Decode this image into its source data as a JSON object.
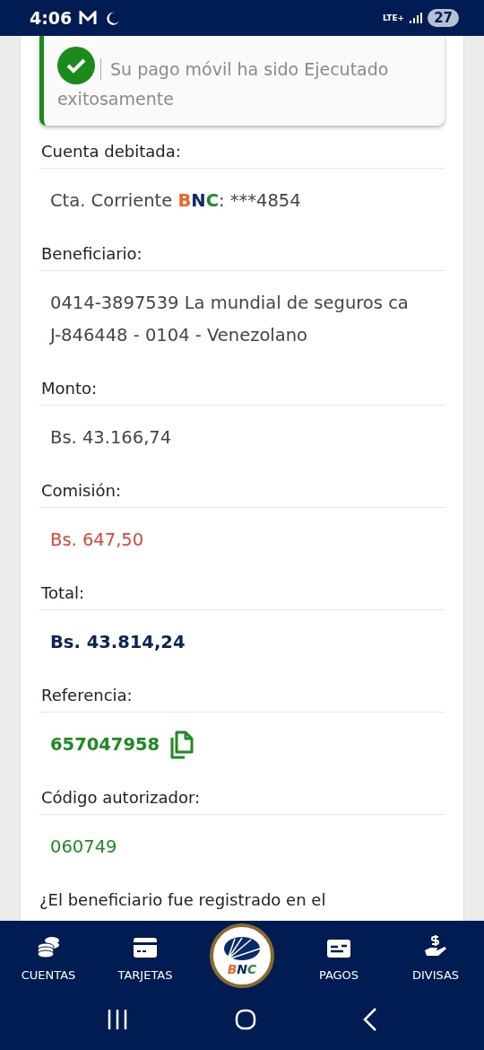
{
  "status_bar": {
    "time": "4:06",
    "network": "LTE+",
    "battery": "27"
  },
  "alert": {
    "message": "Su pago móvil ha sido Ejecutado exitosamente"
  },
  "fields": [
    {
      "label": "Cuenta debitada:",
      "kind": "account",
      "prefix": "Cta. Corriente ",
      "brand": [
        {
          "text": "B",
          "color": "#f26522"
        },
        {
          "text": "N",
          "color": "#0a2a6b"
        },
        {
          "text": "C",
          "color": "#1f8a2e"
        }
      ],
      "suffix": ": ***4854"
    },
    {
      "label": "Beneficiario:",
      "kind": "plain",
      "lines": [
        "0414-3897539 La mundial de seguros ca",
        "J-846448 - 0104 - Venezolano"
      ]
    },
    {
      "label": "Monto:",
      "kind": "plain",
      "lines": [
        "Bs. 43.166,74"
      ]
    },
    {
      "label": "Comisión:",
      "kind": "fee",
      "lines": [
        "Bs. 647,50"
      ]
    },
    {
      "label": "Total:",
      "kind": "total",
      "lines": [
        "Bs. 43.814,24"
      ]
    },
    {
      "label": "Referencia:",
      "kind": "reference",
      "lines": [
        "657047958"
      ]
    },
    {
      "label": "Código autorizador:",
      "kind": "code",
      "lines": [
        "060749"
      ]
    }
  ],
  "question": "¿El beneficiario fue registrado en el",
  "nav": [
    {
      "label": "CUENTAS"
    },
    {
      "label": "TARJETAS"
    },
    {
      "label": "BNC",
      "kind": "logo"
    },
    {
      "label": "PAGOS"
    },
    {
      "label": "DIVISAS"
    }
  ]
}
